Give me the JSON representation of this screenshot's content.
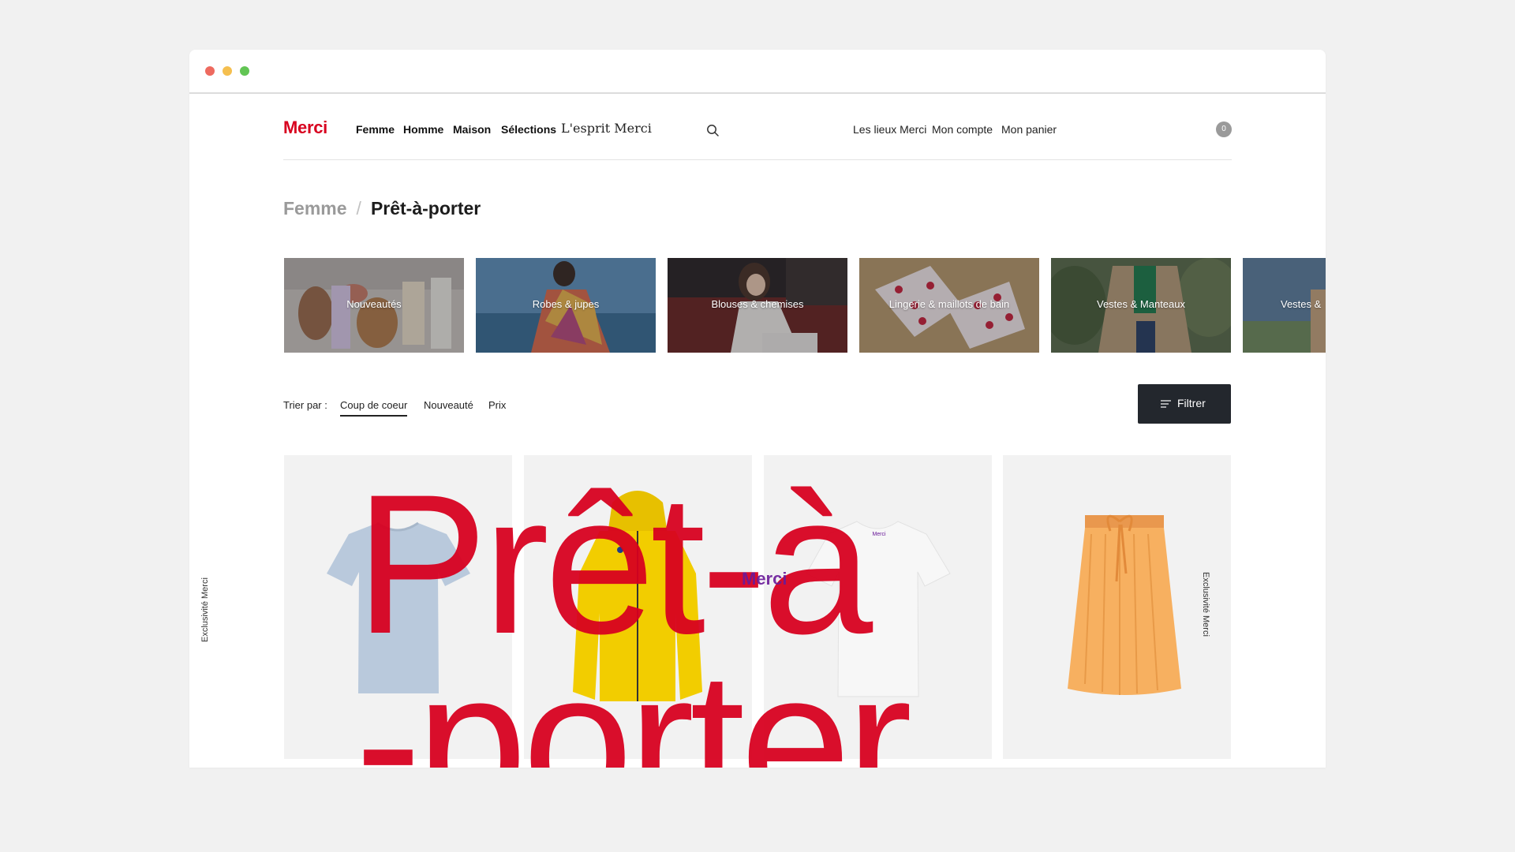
{
  "brand": {
    "logo": "Merci",
    "accent": "#d8001f"
  },
  "window_dots": [
    "#ee6a5f",
    "#f5bf4f",
    "#62c554"
  ],
  "nav": {
    "primary": [
      "Femme",
      "Homme",
      "Maison",
      "Sélections"
    ],
    "serif_item": "L'esprit Merci",
    "search_icon": "search-icon",
    "right": [
      "Les lieux Merci",
      "Mon compte",
      "Mon panier"
    ],
    "cart_count": "0"
  },
  "breadcrumb": {
    "parent": "Femme",
    "separator": "/",
    "current": "Prêt-à-porter"
  },
  "categories": [
    "Nouveautés",
    "Robes & jupes",
    "Blouses & chemises",
    "Lingerie & maillots de bain",
    "Vestes & Manteaux",
    "Vestes &"
  ],
  "sort": {
    "label": "Trier par :",
    "options": [
      "Coup de coeur",
      "Nouveauté",
      "Prix"
    ],
    "active": "Coup de coeur"
  },
  "filter": {
    "label": "Filtrer"
  },
  "products": [
    {
      "item": "t-shirt",
      "color": "#b9c9dc"
    },
    {
      "item": "rain-jacket",
      "color": "#f2cd00"
    },
    {
      "item": "t-shirt",
      "color": "#f4f4f4",
      "print": "Merci"
    },
    {
      "item": "skirt",
      "color": "#f7b060",
      "side_label": "Exclusivité Merci"
    }
  ],
  "overlay_title": {
    "line1": "Prêt-à",
    "line2": "-porter"
  }
}
